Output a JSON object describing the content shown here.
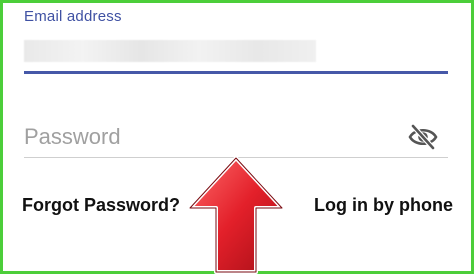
{
  "form": {
    "email_label": "Email address",
    "email_value": "",
    "password_placeholder": "Password",
    "password_value": "",
    "visibility_icon": "eye-off-icon"
  },
  "links": {
    "forgot_password": "Forgot Password?",
    "login_by_phone": "Log in by phone"
  },
  "annotation": {
    "arrow_color": "#e3202a",
    "frame_color": "#4cce3a"
  }
}
